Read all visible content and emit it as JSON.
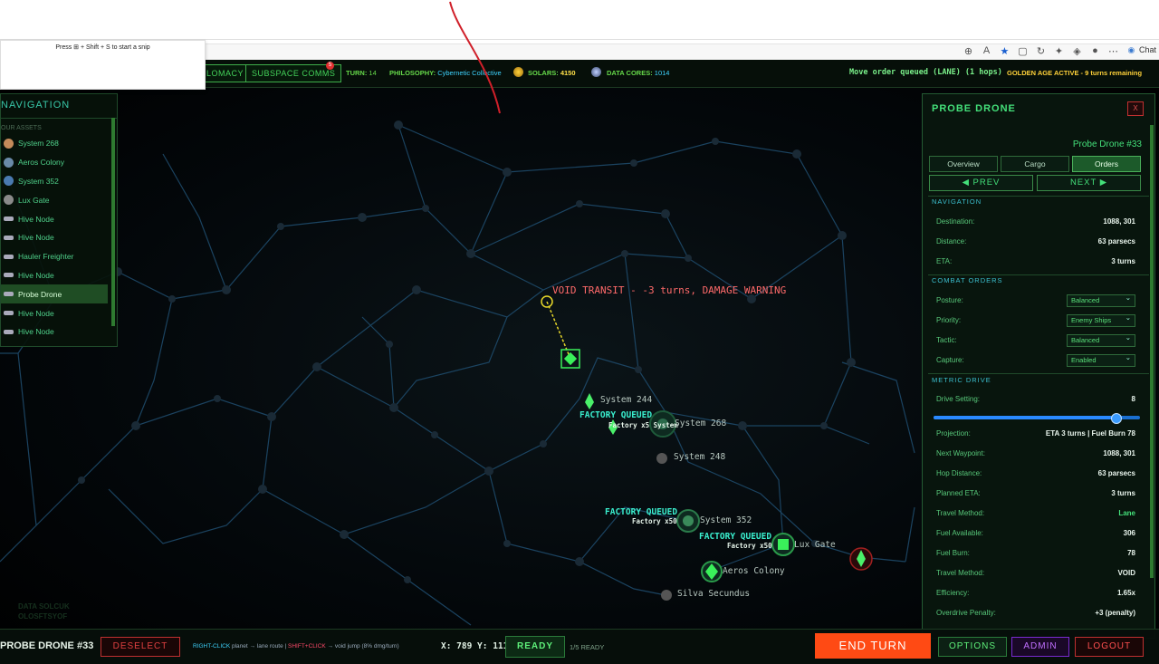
{
  "snip": {
    "text": "Press ⊞ + Shift + S to start a snip"
  },
  "browser": {
    "chat_label": "Chat"
  },
  "topbar": {
    "diplomacy_label": "LOMACY",
    "comms_label": "SUBSPACE COMMS",
    "comms_badge": "5",
    "turn_label": "TURN:",
    "turn_value": "14",
    "philosophy_label": "PHILOSOPHY:",
    "philosophy_value": "Cybernetic Collective",
    "solars_label": "SOLARS:",
    "solars_value": "4150",
    "datacores_label": "DATA CORES:",
    "datacores_value": "1014",
    "order_status": "Move order queued (LANE) (1 hops)",
    "golden_age": "GOLDEN AGE ACTIVE - 9 turns remaining"
  },
  "nav": {
    "title": "NAVIGATION",
    "subtitle": "OUR ASSETS",
    "items": [
      {
        "label": "System 268",
        "icon": "planet-icon",
        "color": "#c48a5a"
      },
      {
        "label": "Aeros Colony",
        "icon": "planet-icon",
        "color": "#6a8aa8"
      },
      {
        "label": "System 352",
        "icon": "planet-icon",
        "color": "#4a7ab0"
      },
      {
        "label": "Lux Gate",
        "icon": "gate-icon",
        "color": "#8a8a8a"
      },
      {
        "label": "Hive Node",
        "icon": "ship-icon",
        "color": "#aab"
      },
      {
        "label": "Hive Node",
        "icon": "ship-icon",
        "color": "#aab"
      },
      {
        "label": "Hauler Freighter",
        "icon": "ship-icon",
        "color": "#aab"
      },
      {
        "label": "Hive Node",
        "icon": "ship-icon",
        "color": "#aab"
      },
      {
        "label": "Probe Drone",
        "icon": "drone-icon",
        "color": "#aab",
        "selected": true
      },
      {
        "label": "Hive Node",
        "icon": "ship-icon",
        "color": "#aab"
      },
      {
        "label": "Hive Node",
        "icon": "ship-icon",
        "color": "#aab"
      }
    ]
  },
  "map": {
    "warning": "VOID TRANSIT - -3 turns, DAMAGE WARNING",
    "systems": [
      {
        "label": "System 244"
      },
      {
        "label": "System 268"
      },
      {
        "label": "System 248"
      },
      {
        "label": "System 352"
      },
      {
        "label": "Lux Gate"
      },
      {
        "label": "Aeros Colony"
      },
      {
        "label": "Silva Secundus"
      }
    ],
    "factory_queued": "FACTORY QUEUED",
    "factory_x50": "Factory x50",
    "overlap_label": "Factory x5 System",
    "watermark_1": "DATA SOLCUK",
    "watermark_2": "OLOSFTSYOF"
  },
  "panel": {
    "title": "PROBE DRONE",
    "close": "X",
    "unit_name": "Probe Drone #33",
    "tabs": [
      "Overview",
      "Cargo",
      "Orders"
    ],
    "active_tab": "Orders",
    "prev": "◀ PREV",
    "next": "NEXT ▶",
    "navigation_title": "NAVIGATION",
    "destination_k": "Destination:",
    "destination_v": "1088, 301",
    "distance_k": "Distance:",
    "distance_v": "63 parsecs",
    "eta_k": "ETA:",
    "eta_v": "3 turns",
    "combat_title": "COMBAT ORDERS",
    "posture_k": "Posture:",
    "posture_v": "Balanced",
    "priority_k": "Priority:",
    "priority_v": "Enemy Ships",
    "tactic_k": "Tactic:",
    "tactic_v": "Balanced",
    "capture_k": "Capture:",
    "capture_v": "Enabled",
    "metric_title": "METRIC DRIVE",
    "drive_k": "Drive Setting:",
    "drive_v": "8",
    "drive_fraction": 0.88,
    "projection_k": "Projection:",
    "projection_v": "ETA 3 turns | Fuel Burn 78",
    "waypoint_k": "Next Waypoint:",
    "waypoint_v": "1088, 301",
    "hop_k": "Hop Distance:",
    "hop_v": "63 parsecs",
    "planned_k": "Planned ETA:",
    "planned_v": "3 turns",
    "method1_k": "Travel Method:",
    "method1_v": "Lane",
    "fuel_k": "Fuel Available:",
    "fuel_v": "306",
    "burn_k": "Fuel Burn:",
    "burn_v": "78",
    "method2_k": "Travel Method:",
    "method2_v": "VOID",
    "eff_k": "Efficiency:",
    "eff_v": "1.65x",
    "over_k": "Overdrive Penalty:",
    "over_v": "+3 (penalty)"
  },
  "bottombar": {
    "unit": "PROBE DRONE #33",
    "deselect": "DESELECT",
    "hint_rc": "RIGHT-CLICK",
    "hint_rc_text": " planet → lane route  |  ",
    "hint_sc": "SHIFT+CLICK",
    "hint_sc_text": " → void jump (8% dmg/turn)",
    "coords": "X: 789 Y: 111",
    "ready": "READY",
    "ready_count": "1/5 READY",
    "end_turn": "END TURN",
    "options": "OPTIONS",
    "admin": "ADMIN",
    "logout": "LOGOUT"
  },
  "colors": {
    "accent_green": "#44e07a",
    "end_turn": "#ff4a14",
    "admin": "#a64aff",
    "danger": "#e03a3a"
  }
}
